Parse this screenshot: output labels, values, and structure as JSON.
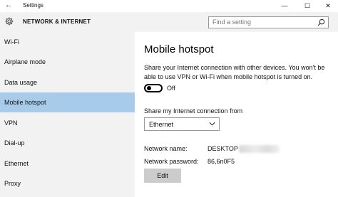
{
  "window": {
    "back_icon": "back-arrow-icon",
    "title": "Settings",
    "minimize_icon": "minimize-icon",
    "maximize_icon": "maximize-icon",
    "close_icon": "close-icon"
  },
  "header": {
    "icon": "gear-icon",
    "title": "NETWORK & INTERNET"
  },
  "search": {
    "placeholder": "Find a setting",
    "icon": "search-icon"
  },
  "sidebar": {
    "items": [
      {
        "label": "Wi-Fi",
        "active": false
      },
      {
        "label": "Airplane mode",
        "active": false
      },
      {
        "label": "Data usage",
        "active": false
      },
      {
        "label": "Mobile hotspot",
        "active": true
      },
      {
        "label": "VPN",
        "active": false
      },
      {
        "label": "Dial-up",
        "active": false
      },
      {
        "label": "Ethernet",
        "active": false
      },
      {
        "label": "Proxy",
        "active": false
      }
    ],
    "active_color": "#a8cbe9"
  },
  "main": {
    "title": "Mobile hotspot",
    "description": "Share your Internet connection with other devices. You won't be able to use VPN or Wi-Fi when mobile hotspot is turned on.",
    "toggle": {
      "state": "Off"
    },
    "share_label": "Share my Internet connection from",
    "share_dropdown": {
      "value": "Ethernet",
      "icon": "chevron-down-icon"
    },
    "network_name_label": "Network name:",
    "network_name_value": "DESKTOP",
    "network_password_label": "Network password:",
    "network_password_value": "86,6n0F5",
    "edit_label": "Edit"
  }
}
